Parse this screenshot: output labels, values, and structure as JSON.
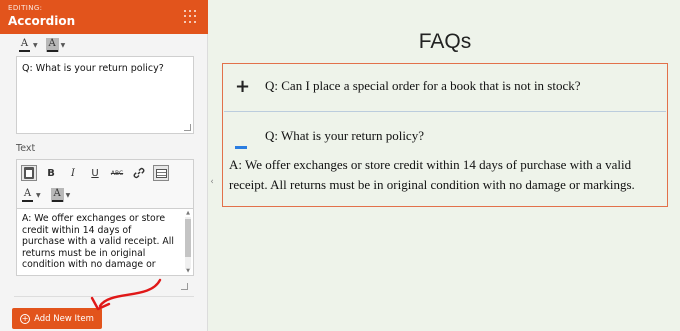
{
  "panel": {
    "editing_label": "EDITING:",
    "title": "Accordion"
  },
  "question_field": {
    "value": "Q: What is your return policy?"
  },
  "text_field": {
    "label": "Text",
    "value_lines": [
      "A: We offer exchanges or store",
      "credit within 14 days of",
      "purchase with a valid receipt. All",
      "returns must be in original",
      "condition with no damage or"
    ]
  },
  "toolbar": {
    "font_color_glyph": "A",
    "bg_color_glyph": "A",
    "bold": "B",
    "italic": "I",
    "underline": "U",
    "strike": "ABC",
    "link_icon": "link-icon"
  },
  "add_button": {
    "label": "Add New Item"
  },
  "preview": {
    "heading": "FAQs",
    "items": [
      {
        "sign": "+",
        "question": "Q: Can I place a special order for a book that is not in stock?"
      },
      {
        "sign": "−",
        "question": "Q: What is your return policy?"
      }
    ],
    "answer": "A: We offer exchanges or store credit within 14 days of purchase with a valid receipt. All returns must be in original condition with no damage or markings."
  },
  "colors": {
    "accent": "#e2541c",
    "minus": "#2a7de1",
    "preview_bg": "#eef3ea"
  }
}
